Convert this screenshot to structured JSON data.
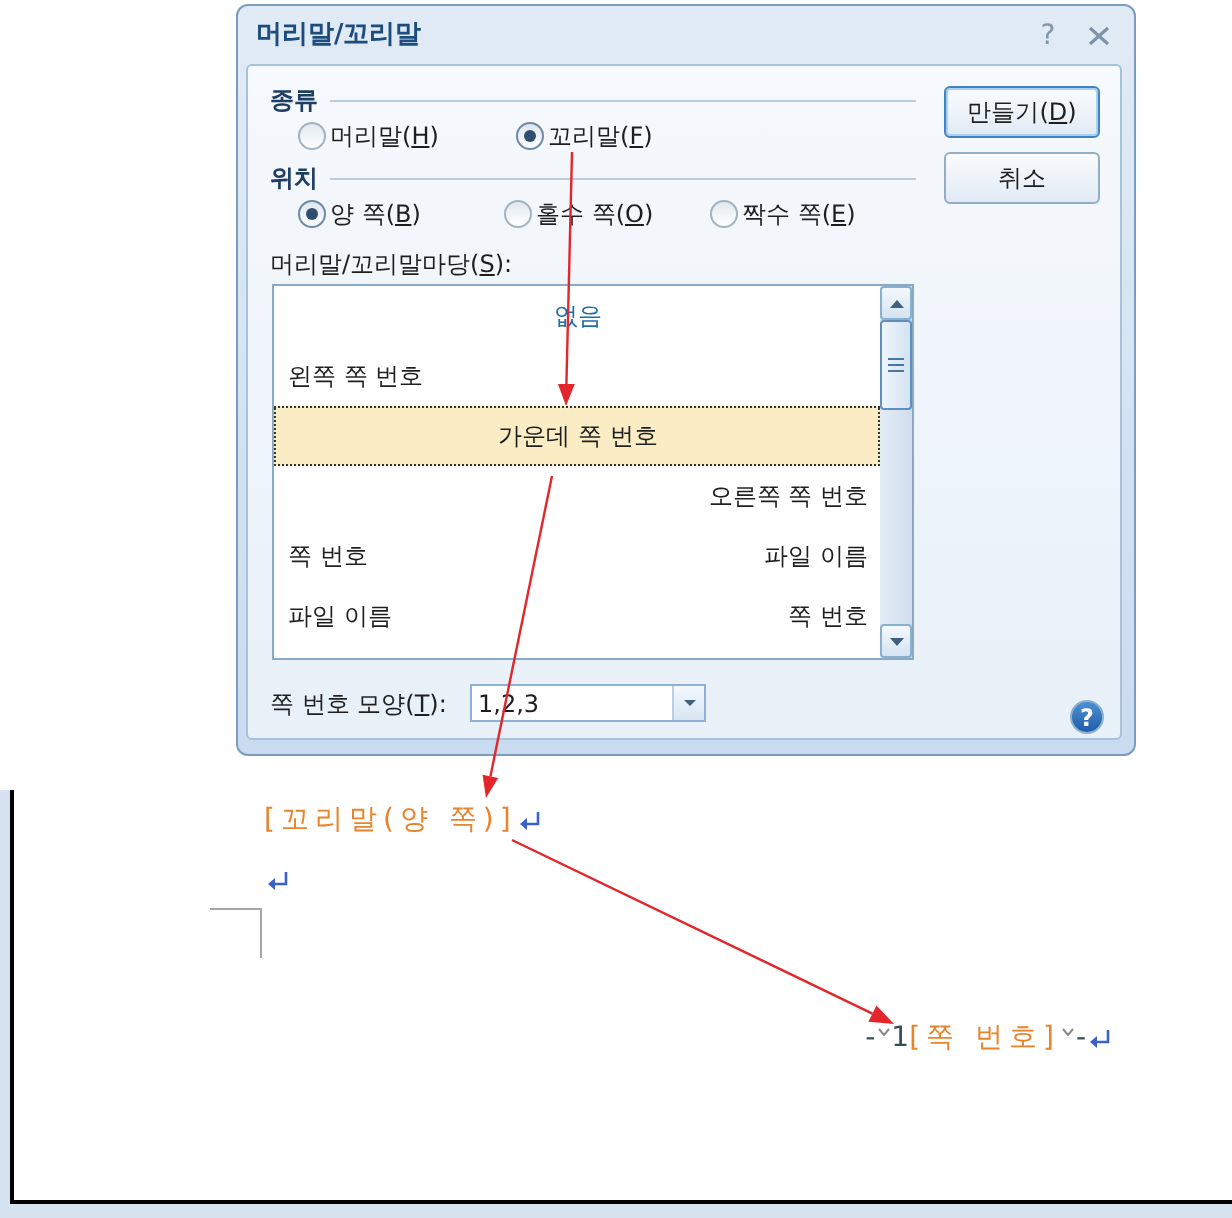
{
  "dialog": {
    "title": "머리말/꼬리말",
    "help": "?",
    "groups": [
      {
        "title": "종류",
        "options": [
          {
            "label": "머리말(H)",
            "selected": false
          },
          {
            "label": "꼬리말(F)",
            "selected": true
          }
        ]
      },
      {
        "title": "위치",
        "options": [
          {
            "label": "양 쪽(B)",
            "selected": true
          },
          {
            "label": "홀수 쪽(O)",
            "selected": false
          },
          {
            "label": "짝수 쪽(E)",
            "selected": false
          }
        ]
      }
    ],
    "gallery": {
      "label": "머리말/꼬리말마당(S):",
      "items": [
        {
          "kind": "none",
          "text": "없음",
          "selected": false
        },
        {
          "kind": "left",
          "text": "왼쪽 쪽 번호",
          "selected": false
        },
        {
          "kind": "center",
          "text": "가운데 쪽 번호",
          "selected": true
        },
        {
          "kind": "right",
          "text": "오른쪽 쪽 번호",
          "selected": false
        },
        {
          "kind": "split",
          "left": "쪽 번호",
          "right": "파일 이름",
          "selected": false
        },
        {
          "kind": "split",
          "left": "파일 이름",
          "right": "쪽 번호",
          "selected": false
        }
      ]
    },
    "buttons": [
      {
        "label": "만들기(D)",
        "default": true
      },
      {
        "label": "취소",
        "default": false
      }
    ],
    "format": {
      "label": "쪽 번호 모양(T):",
      "value": "1,2,3"
    },
    "help_button": "?"
  },
  "document": {
    "lines": [
      {
        "runs": [
          {
            "kind": "field",
            "text": "[꼬리말(양 쪽)]"
          },
          {
            "kind": "paragraph_end"
          }
        ]
      },
      {
        "runs": [
          {
            "kind": "paragraph_end"
          }
        ]
      }
    ],
    "footer": {
      "runs": [
        {
          "kind": "text",
          "text": "-"
        },
        {
          "kind": "space"
        },
        {
          "kind": "text",
          "text": "1"
        },
        {
          "kind": "field",
          "text": "[쪽 번호]"
        },
        {
          "kind": "space"
        },
        {
          "kind": "text",
          "text": "-"
        },
        {
          "kind": "paragraph_end"
        }
      ]
    }
  }
}
